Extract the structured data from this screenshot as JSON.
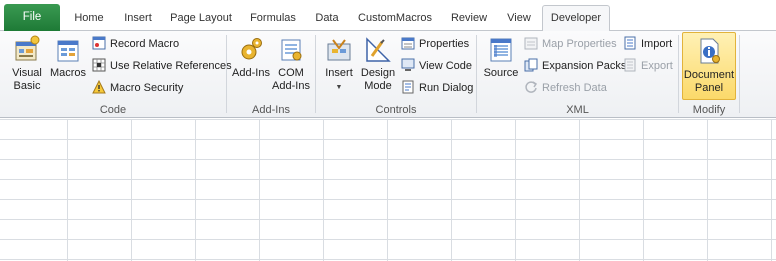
{
  "tabs": {
    "file": "File",
    "home": "Home",
    "insert": "Insert",
    "page_layout": "Page Layout",
    "formulas": "Formulas",
    "data": "Data",
    "custom_macros": "CustomMacros",
    "review": "Review",
    "view": "View",
    "developer": "Developer"
  },
  "groups": {
    "code": {
      "label": "Code",
      "visual_basic_1": "Visual",
      "visual_basic_2": "Basic",
      "macros": "Macros",
      "record_macro": "Record Macro",
      "use_relative": "Use Relative References",
      "macro_security": "Macro Security"
    },
    "addins": {
      "label": "Add-Ins",
      "addins": "Add-Ins",
      "com_1": "COM",
      "com_2": "Add-Ins"
    },
    "controls": {
      "label": "Controls",
      "insert": "Insert",
      "design_1": "Design",
      "design_2": "Mode",
      "properties": "Properties",
      "view_code": "View Code",
      "run_dialog": "Run Dialog"
    },
    "xml": {
      "label": "XML",
      "source": "Source",
      "map_properties": "Map Properties",
      "expansion_packs": "Expansion Packs",
      "refresh_data": "Refresh Data",
      "import": "Import",
      "export": "Export"
    },
    "modify": {
      "label": "Modify",
      "doc_1": "Document",
      "doc_2": "Panel"
    }
  },
  "colors": {
    "file_tab": "#1e7a36",
    "highlight": "#fbd96a",
    "grid_line": "#d9dde2"
  }
}
